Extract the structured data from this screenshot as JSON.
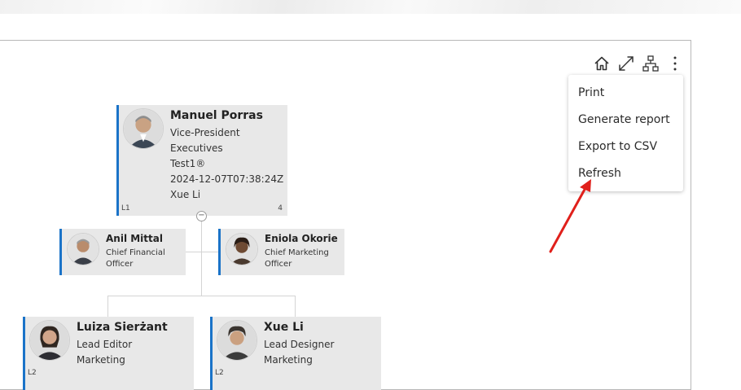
{
  "menu": {
    "items": [
      {
        "label": "Print"
      },
      {
        "label": "Generate report"
      },
      {
        "label": "Export to CSV"
      },
      {
        "label": "Refresh"
      }
    ]
  },
  "toolbar": {
    "icons": [
      "home-icon",
      "expand-icon",
      "hierarchy-icon",
      "more-vertical-icon"
    ]
  },
  "nodes": {
    "root": {
      "name": "Manuel Porras",
      "lines": [
        "Vice-President",
        "Executives",
        "Test1®",
        "2024-12-07T07:38:24Z",
        "Xue Li"
      ],
      "level": "L1",
      "count": "4"
    },
    "assistant1": {
      "name": "Anil Mittal",
      "lines": [
        "Chief Financial",
        "Officer"
      ]
    },
    "assistant2": {
      "name": "Eniola Okorie",
      "lines": [
        "Chief Marketing",
        "Officer"
      ]
    },
    "child1": {
      "name": "Luiza Sierżant",
      "lines": [
        "Lead Editor",
        "Marketing"
      ],
      "level": "L2"
    },
    "child2": {
      "name": "Xue Li",
      "lines": [
        "Lead Designer",
        "Marketing"
      ],
      "level": "L2"
    }
  },
  "colors": {
    "accent": "#1a73c8",
    "node_bg": "#e8e8e8",
    "arrow": "#e0201b"
  }
}
